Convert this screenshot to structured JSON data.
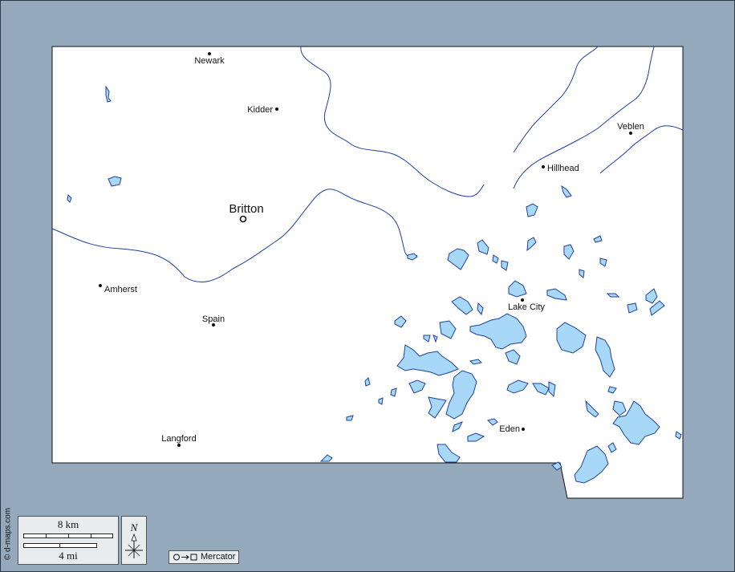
{
  "map": {
    "capital": {
      "name": "Britton"
    },
    "cities": [
      {
        "name": "Newark"
      },
      {
        "name": "Kidder"
      },
      {
        "name": "Veblen"
      },
      {
        "name": "Hillhead"
      },
      {
        "name": "Amherst"
      },
      {
        "name": "Spain"
      },
      {
        "name": "Lake City"
      },
      {
        "name": "Eden"
      },
      {
        "name": "Langford"
      }
    ],
    "colors": {
      "background": "#95a9bd",
      "land": "#ffffff",
      "water": "#a8d8f8",
      "water_outline": "#1f3f9f",
      "border": "#111111"
    }
  },
  "scale": {
    "metric_label": "8 km",
    "imperial_label": "4 mi"
  },
  "compass": {
    "label": "N",
    "icon": "compass-rose-icon"
  },
  "projection": {
    "label": "Mercator",
    "icon": "circle-to-square-icon"
  },
  "credit": "© d-maps.com"
}
